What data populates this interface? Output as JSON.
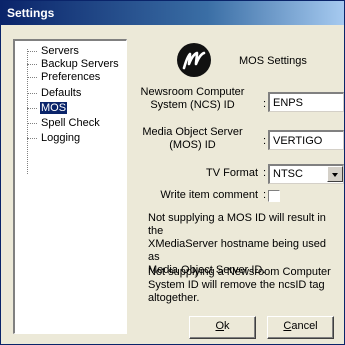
{
  "window": {
    "title": "Settings"
  },
  "tree": {
    "items": [
      {
        "label": "Servers"
      },
      {
        "label": "Backup Servers"
      },
      {
        "label": "Preferences"
      },
      {
        "label": "Defaults"
      },
      {
        "label": "MOS",
        "selected": true
      },
      {
        "label": "Spell Check"
      },
      {
        "label": "Logging"
      }
    ]
  },
  "header": {
    "logo_icon": "mos-logo-icon",
    "title": "MOS Settings"
  },
  "form": {
    "ncs": {
      "label_line1": "Newsroom Computer",
      "label_line2": "System (NCS) ID",
      "value": "ENPS"
    },
    "mos": {
      "label_line1": "Media Object Server",
      "label_line2": "(MOS) ID",
      "value": "VERTIGO"
    },
    "tv_format": {
      "label": "TV Format",
      "value": "NTSC"
    },
    "write_comment": {
      "label": "Write item comment",
      "checked": false
    },
    "colon": ":"
  },
  "info": {
    "p1_l1": "Not supplying a MOS ID will result in the",
    "p1_l2": "XMediaServer hostname being used as",
    "p1_l3": "Media Object Server ID.",
    "p2_l1": "Not supplying a Newsroom Computer",
    "p2_l2": "System ID will remove the ncsID tag",
    "p2_l3": "altogether."
  },
  "buttons": {
    "ok_mnemonic": "O",
    "ok_rest": "k",
    "cancel_mnemonic": "C",
    "cancel_rest": "ancel"
  },
  "colors": {
    "title_bar": "#0a246a",
    "selection": "#0a246a",
    "dialog_bg": "#ece9d8"
  }
}
